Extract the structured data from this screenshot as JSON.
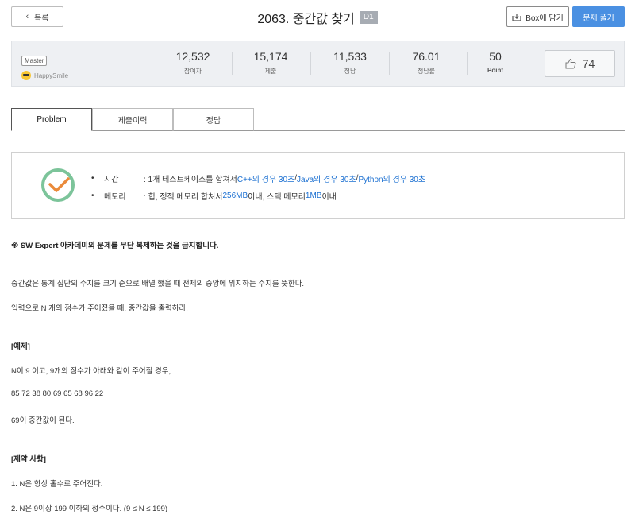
{
  "header": {
    "back_label": "목록",
    "title": "2063. 중간값 찾기",
    "difficulty": "D1",
    "box_label": "Box에 담기",
    "solve_label": "문제 풀기"
  },
  "author": {
    "level": "Master",
    "name": "HappySmile"
  },
  "stats": [
    {
      "value": "12,532",
      "label": "참여자"
    },
    {
      "value": "15,174",
      "label": "제출"
    },
    {
      "value": "11,533",
      "label": "정답"
    },
    {
      "value": "76.01",
      "label": "정답률"
    },
    {
      "value": "50",
      "label": "Point"
    }
  ],
  "likes": "74",
  "tabs": [
    "Problem",
    "제출이력",
    "정답"
  ],
  "limits": {
    "time_label": "시간",
    "time_prefix": ": 1개 테스트케이스를 합쳐서 ",
    "time_cpp": "C++의 경우 30초",
    "sep1": " / ",
    "time_java": "Java의 경우 30초",
    "sep2": " / ",
    "time_python": "Python의 경우 30초",
    "memory_label": "메모리",
    "memory_prefix": ": 힙, 정적 메모리 합쳐서 ",
    "memory_heap": "256MB",
    "memory_mid": " 이내, 스택 메모리 ",
    "memory_stack": "1MB",
    "memory_suffix": " 이내"
  },
  "body": {
    "notice": "※ SW Expert 아카데미의 문제를 무단 복제하는 것을 금지합니다.",
    "desc1": "중간값은 통계 집단의 수치를 크기 순으로 배열 했을 때 전체의 중앙에 위치하는 수치를 뜻한다.",
    "desc2": "입력으로 N 개의 점수가 주어졌을 때, 중간값을 출력하라.",
    "example_heading": "[예제]",
    "example1": "N이 9 이고, 9개의 점수가 아래와 같이 주어질 경우,",
    "example2": "85 72 38 80 69 65 68 96 22",
    "example3": "69이 중간값이 된다.",
    "constraints_heading": "[제약 사항]",
    "constraint1": "1. N은 항상 홀수로 주어진다.",
    "constraint2": "2. N은 9이상 199 이하의 정수이다. (9 ≤ N ≤ 199)"
  },
  "colors": {
    "primary_button": "#4a90e2",
    "link_blue": "#1a6fd1",
    "clock_green": "#7cc49a",
    "clock_orange": "#ea8a3a"
  }
}
